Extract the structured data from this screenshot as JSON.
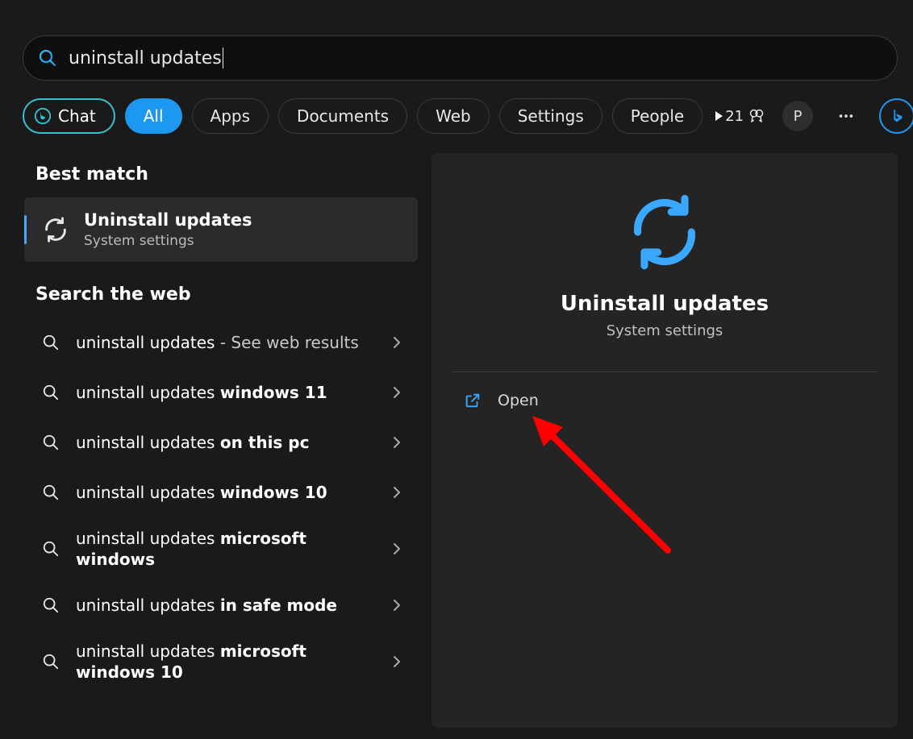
{
  "search": {
    "value": "uninstall updates"
  },
  "filters": {
    "chat": "Chat",
    "all": "All",
    "apps": "Apps",
    "documents": "Documents",
    "web": "Web",
    "settings": "Settings",
    "people": "People"
  },
  "header": {
    "points": "21",
    "avatar_initial": "P"
  },
  "left": {
    "best_match_label": "Best match",
    "best_match_title": "Uninstall updates",
    "best_match_subtitle": "System settings",
    "search_web_label": "Search the web",
    "web_items": [
      {
        "prefix": "uninstall updates",
        "bold": "",
        "suffix": " - See web results",
        "suffix_dim": true
      },
      {
        "prefix": "uninstall updates ",
        "bold": "windows 11",
        "suffix": ""
      },
      {
        "prefix": "uninstall updates ",
        "bold": "on this pc",
        "suffix": ""
      },
      {
        "prefix": "uninstall updates ",
        "bold": "windows 10",
        "suffix": ""
      },
      {
        "prefix": "uninstall updates ",
        "bold": "microsoft windows",
        "suffix": "",
        "tall": true
      },
      {
        "prefix": "uninstall updates ",
        "bold": "in safe mode",
        "suffix": ""
      },
      {
        "prefix": "uninstall updates ",
        "bold": "microsoft windows 10",
        "suffix": "",
        "tall": true
      }
    ]
  },
  "detail": {
    "title": "Uninstall updates",
    "subtitle": "System settings",
    "open_label": "Open"
  }
}
